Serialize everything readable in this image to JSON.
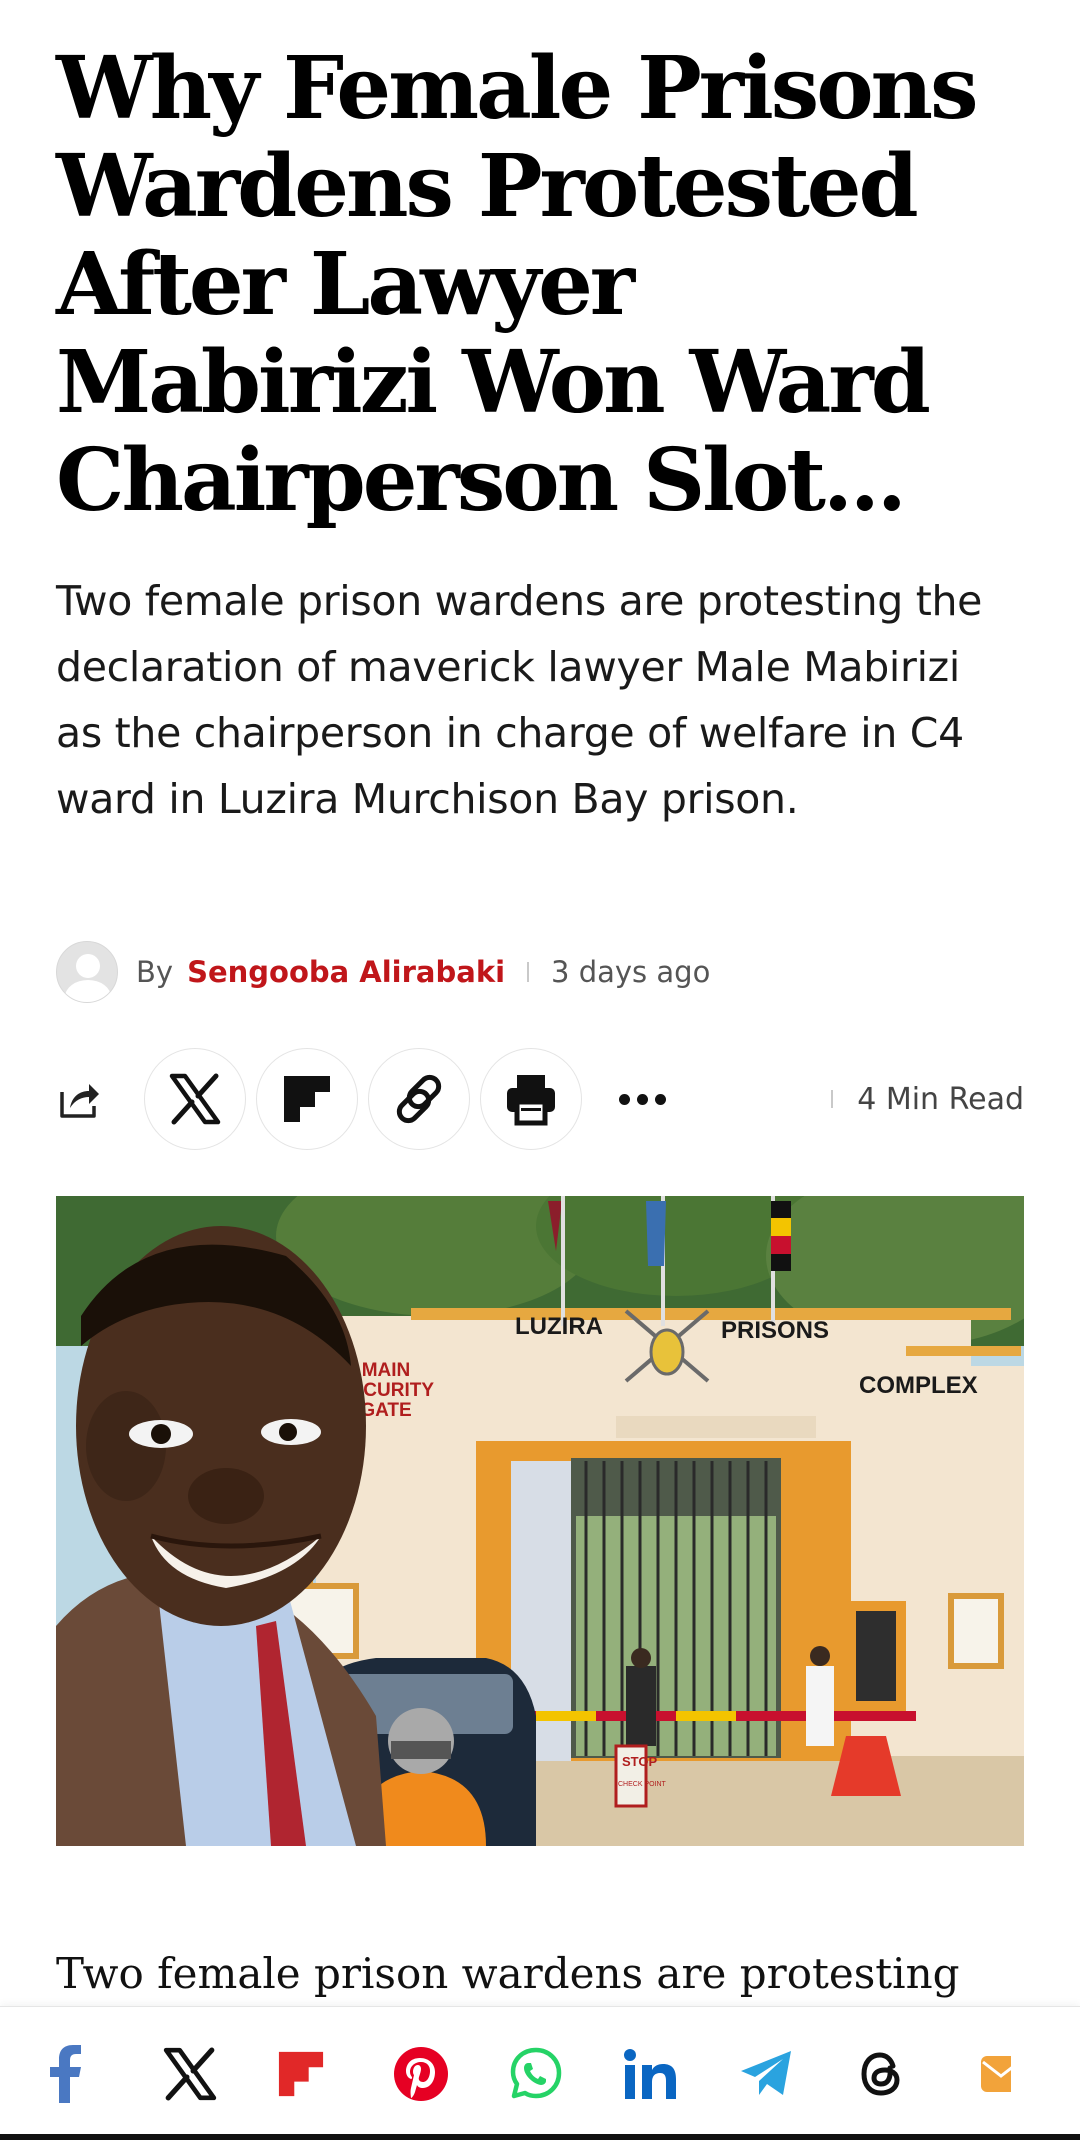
{
  "article": {
    "headline": "Why Female Prisons Wardens Protested After Lawyer Mabirizi Won Ward Chairperson Slot...",
    "excerpt": "Two female prison wardens are protesting the declaration of maverick lawyer Male Mabirizi as the chairperson in charge of welfare in C4 ward in Luzira Murchison Bay prison.",
    "byline": {
      "by_label": "By",
      "author": "Sengooba Alirabaki",
      "date": "3 days ago"
    },
    "read_time": "4 Min Read",
    "hero_image": {
      "signs": {
        "main_gate": [
          "MAIN",
          "SECURITY",
          "GATE"
        ],
        "luzira": "LUZIRA",
        "prisons": "PRISONS",
        "complex": "COMPLEX",
        "stop": "STOP",
        "checkpoint": "CHECK POINT"
      }
    },
    "body_first_line": "Two female prison wardens are protesting"
  },
  "share_icons": [
    "share-icon",
    "x-icon",
    "flipboard-icon",
    "copy-link-icon",
    "print-icon",
    "more-icon"
  ],
  "bottom_share_icons": [
    "facebook-icon",
    "x-icon",
    "flipboard-icon",
    "pinterest-icon",
    "whatsapp-icon",
    "linkedin-icon",
    "telegram-icon",
    "threads-icon",
    "email-icon"
  ],
  "colors": {
    "author": "#c0161a",
    "facebook": "#4a78c2",
    "flipboard": "#e12828",
    "pinterest": "#e60023",
    "whatsapp": "#25d366",
    "linkedin": "#0a66c2",
    "telegram": "#2aa3df",
    "email": "#f2a33a"
  }
}
